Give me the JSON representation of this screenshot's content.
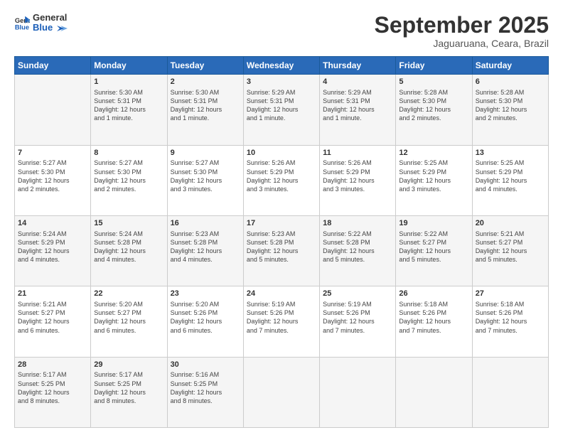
{
  "logo": {
    "line1": "General",
    "line2": "Blue"
  },
  "header": {
    "title": "September 2025",
    "subtitle": "Jaguaruana, Ceara, Brazil"
  },
  "weekdays": [
    "Sunday",
    "Monday",
    "Tuesday",
    "Wednesday",
    "Thursday",
    "Friday",
    "Saturday"
  ],
  "weeks": [
    [
      {
        "day": "",
        "info": ""
      },
      {
        "day": "1",
        "info": "Sunrise: 5:30 AM\nSunset: 5:31 PM\nDaylight: 12 hours\nand 1 minute."
      },
      {
        "day": "2",
        "info": "Sunrise: 5:30 AM\nSunset: 5:31 PM\nDaylight: 12 hours\nand 1 minute."
      },
      {
        "day": "3",
        "info": "Sunrise: 5:29 AM\nSunset: 5:31 PM\nDaylight: 12 hours\nand 1 minute."
      },
      {
        "day": "4",
        "info": "Sunrise: 5:29 AM\nSunset: 5:31 PM\nDaylight: 12 hours\nand 1 minute."
      },
      {
        "day": "5",
        "info": "Sunrise: 5:28 AM\nSunset: 5:30 PM\nDaylight: 12 hours\nand 2 minutes."
      },
      {
        "day": "6",
        "info": "Sunrise: 5:28 AM\nSunset: 5:30 PM\nDaylight: 12 hours\nand 2 minutes."
      }
    ],
    [
      {
        "day": "7",
        "info": "Sunrise: 5:27 AM\nSunset: 5:30 PM\nDaylight: 12 hours\nand 2 minutes."
      },
      {
        "day": "8",
        "info": "Sunrise: 5:27 AM\nSunset: 5:30 PM\nDaylight: 12 hours\nand 2 minutes."
      },
      {
        "day": "9",
        "info": "Sunrise: 5:27 AM\nSunset: 5:30 PM\nDaylight: 12 hours\nand 3 minutes."
      },
      {
        "day": "10",
        "info": "Sunrise: 5:26 AM\nSunset: 5:29 PM\nDaylight: 12 hours\nand 3 minutes."
      },
      {
        "day": "11",
        "info": "Sunrise: 5:26 AM\nSunset: 5:29 PM\nDaylight: 12 hours\nand 3 minutes."
      },
      {
        "day": "12",
        "info": "Sunrise: 5:25 AM\nSunset: 5:29 PM\nDaylight: 12 hours\nand 3 minutes."
      },
      {
        "day": "13",
        "info": "Sunrise: 5:25 AM\nSunset: 5:29 PM\nDaylight: 12 hours\nand 4 minutes."
      }
    ],
    [
      {
        "day": "14",
        "info": "Sunrise: 5:24 AM\nSunset: 5:29 PM\nDaylight: 12 hours\nand 4 minutes."
      },
      {
        "day": "15",
        "info": "Sunrise: 5:24 AM\nSunset: 5:28 PM\nDaylight: 12 hours\nand 4 minutes."
      },
      {
        "day": "16",
        "info": "Sunrise: 5:23 AM\nSunset: 5:28 PM\nDaylight: 12 hours\nand 4 minutes."
      },
      {
        "day": "17",
        "info": "Sunrise: 5:23 AM\nSunset: 5:28 PM\nDaylight: 12 hours\nand 5 minutes."
      },
      {
        "day": "18",
        "info": "Sunrise: 5:22 AM\nSunset: 5:28 PM\nDaylight: 12 hours\nand 5 minutes."
      },
      {
        "day": "19",
        "info": "Sunrise: 5:22 AM\nSunset: 5:27 PM\nDaylight: 12 hours\nand 5 minutes."
      },
      {
        "day": "20",
        "info": "Sunrise: 5:21 AM\nSunset: 5:27 PM\nDaylight: 12 hours\nand 5 minutes."
      }
    ],
    [
      {
        "day": "21",
        "info": "Sunrise: 5:21 AM\nSunset: 5:27 PM\nDaylight: 12 hours\nand 6 minutes."
      },
      {
        "day": "22",
        "info": "Sunrise: 5:20 AM\nSunset: 5:27 PM\nDaylight: 12 hours\nand 6 minutes."
      },
      {
        "day": "23",
        "info": "Sunrise: 5:20 AM\nSunset: 5:26 PM\nDaylight: 12 hours\nand 6 minutes."
      },
      {
        "day": "24",
        "info": "Sunrise: 5:19 AM\nSunset: 5:26 PM\nDaylight: 12 hours\nand 7 minutes."
      },
      {
        "day": "25",
        "info": "Sunrise: 5:19 AM\nSunset: 5:26 PM\nDaylight: 12 hours\nand 7 minutes."
      },
      {
        "day": "26",
        "info": "Sunrise: 5:18 AM\nSunset: 5:26 PM\nDaylight: 12 hours\nand 7 minutes."
      },
      {
        "day": "27",
        "info": "Sunrise: 5:18 AM\nSunset: 5:26 PM\nDaylight: 12 hours\nand 7 minutes."
      }
    ],
    [
      {
        "day": "28",
        "info": "Sunrise: 5:17 AM\nSunset: 5:25 PM\nDaylight: 12 hours\nand 8 minutes."
      },
      {
        "day": "29",
        "info": "Sunrise: 5:17 AM\nSunset: 5:25 PM\nDaylight: 12 hours\nand 8 minutes."
      },
      {
        "day": "30",
        "info": "Sunrise: 5:16 AM\nSunset: 5:25 PM\nDaylight: 12 hours\nand 8 minutes."
      },
      {
        "day": "",
        "info": ""
      },
      {
        "day": "",
        "info": ""
      },
      {
        "day": "",
        "info": ""
      },
      {
        "day": "",
        "info": ""
      }
    ]
  ]
}
